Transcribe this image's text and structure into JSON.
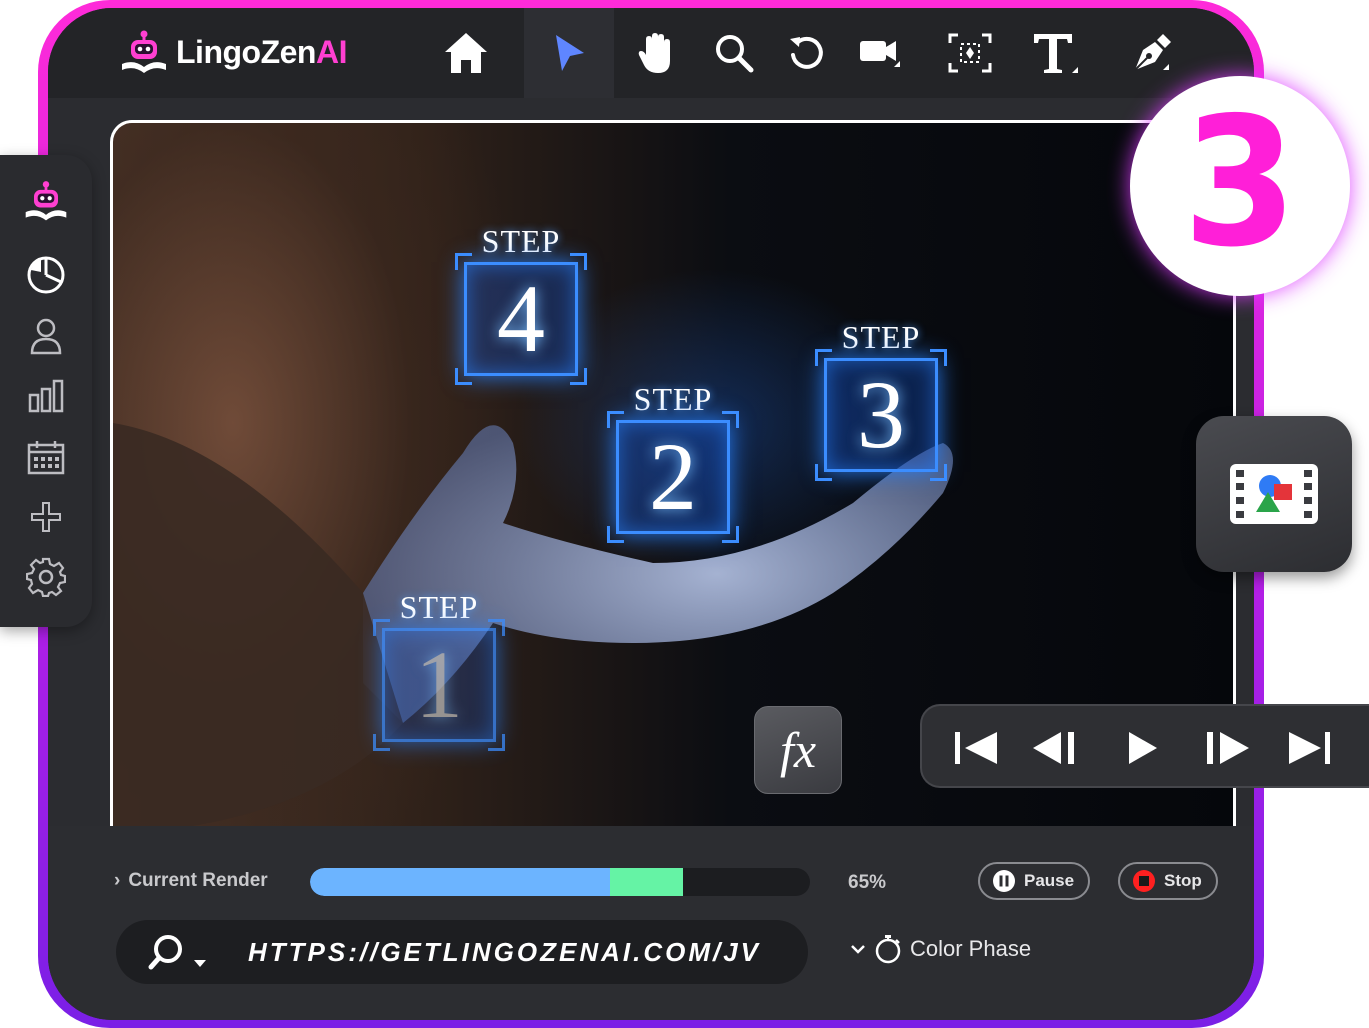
{
  "app": {
    "logo_text": "LingoZen",
    "logo_ai": "AI"
  },
  "toolbar": {
    "tools": [
      "home-icon",
      "pointer-icon",
      "hand-icon",
      "search-icon",
      "undo-icon",
      "camera-icon",
      "focus-icon",
      "text-icon",
      "pen-icon"
    ],
    "active": "pointer-icon"
  },
  "sidebar": {
    "items": [
      "logo-robot-icon",
      "analytics-icon",
      "user-icon",
      "bar-chart-icon",
      "calendar-icon",
      "add-icon",
      "settings-icon"
    ]
  },
  "canvas": {
    "steps": [
      {
        "label": "STEP",
        "number": "4"
      },
      {
        "label": "STEP",
        "number": "2"
      },
      {
        "label": "STEP",
        "number": "3"
      },
      {
        "label": "STEP",
        "number": "1"
      }
    ]
  },
  "badge": {
    "number": "3"
  },
  "fx": {
    "label": "fx"
  },
  "transport": {
    "buttons": [
      "skip-to-start-icon",
      "step-back-icon",
      "play-icon",
      "step-forward-icon",
      "skip-to-end-icon"
    ]
  },
  "render": {
    "label": "Current Render",
    "percent_text": "65%",
    "progress_blue": 0.6,
    "progress_green": 0.745,
    "pause_label": "Pause",
    "stop_label": "Stop"
  },
  "url": {
    "text": "HTTPS://GETLINGOZENAI.COM/JV"
  },
  "phase": {
    "label": "Color Phase"
  },
  "colors": {
    "frame_pink": "#ff2bd9",
    "frame_purple": "#7a1fe6",
    "badge_number": "#ff1fd8",
    "progress_blue": "#6cb4ff",
    "progress_green": "#65f3a5",
    "stop_red": "#ff2020",
    "accent_blue": "#3b8dff"
  }
}
